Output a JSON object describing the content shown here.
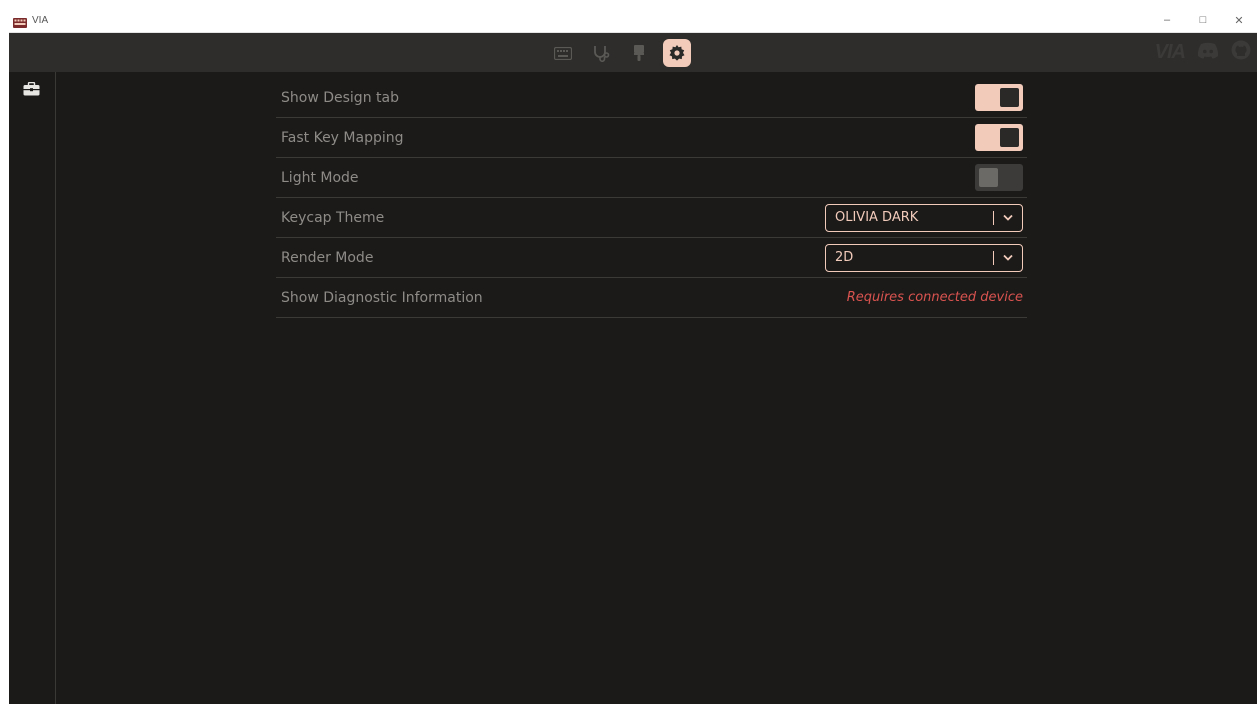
{
  "window": {
    "title": "VIA",
    "controls": {
      "minimize": "–",
      "maximize": "□",
      "close": "✕"
    }
  },
  "topbar": {
    "nav": [
      {
        "name": "keyboard-icon",
        "active": false
      },
      {
        "name": "diagnostics-icon",
        "active": false
      },
      {
        "name": "design-brush-icon",
        "active": false
      },
      {
        "name": "settings-gear-icon",
        "active": true
      }
    ],
    "brand": {
      "logo_text": "VIA"
    }
  },
  "sidebar": {
    "items": [
      {
        "icon": "toolbox-icon"
      }
    ]
  },
  "settings": {
    "rows": [
      {
        "label": "Show Design tab",
        "control": "toggle",
        "on": true
      },
      {
        "label": "Fast Key Mapping",
        "control": "toggle",
        "on": true
      },
      {
        "label": "Light Mode",
        "control": "toggle",
        "on": false
      },
      {
        "label": "Keycap Theme",
        "control": "select",
        "value": "OLIVIA DARK"
      },
      {
        "label": "Render Mode",
        "control": "select",
        "value": "2D"
      },
      {
        "label": "Show Diagnostic Information",
        "control": "note",
        "note": "Requires connected device"
      }
    ]
  },
  "colors": {
    "accent": "#f2cbbb",
    "background": "#1b1a19",
    "topbar": "#2e2d2b",
    "warning": "#d9534f"
  }
}
